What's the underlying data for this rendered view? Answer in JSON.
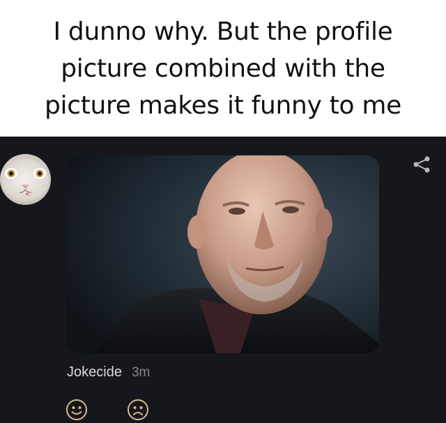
{
  "caption": {
    "text": "I dunno why. But the profile picture combined with the picture makes it funny to me"
  },
  "post": {
    "author": "Jokecide",
    "time": "3m"
  },
  "colors": {
    "background": "#16171c",
    "caption_bg": "#ffffff",
    "reaction_accent": "#d9b98a"
  },
  "icons": {
    "share": "share-icon",
    "happy": "smiley-happy-icon",
    "sad": "smiley-sad-icon"
  }
}
